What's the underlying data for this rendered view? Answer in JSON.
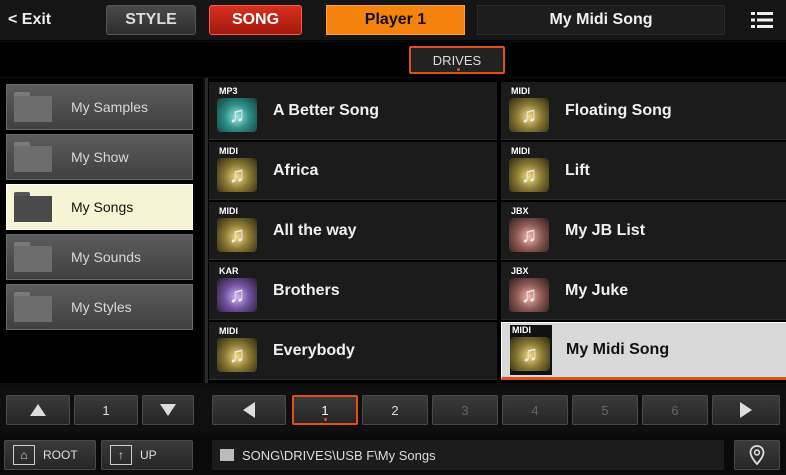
{
  "topbar": {
    "exit_label": "< Exit",
    "style_label": "STYLE",
    "song_label": "SONG",
    "player_label": "Player 1",
    "song_title": "My Midi Song",
    "menu_icon": "hamburger-menu-icon"
  },
  "drives": {
    "label": "DRIVES"
  },
  "folders": [
    {
      "label": "My Samples",
      "selected": false
    },
    {
      "label": "My Show",
      "selected": false
    },
    {
      "label": "My Songs",
      "selected": true
    },
    {
      "label": "My Sounds",
      "selected": false
    },
    {
      "label": "My Styles",
      "selected": false
    }
  ],
  "files": [
    {
      "type": "MP3",
      "name": "A Better Song"
    },
    {
      "type": "MIDI",
      "name": "Floating Song"
    },
    {
      "type": "MIDI",
      "name": "Africa"
    },
    {
      "type": "MIDI",
      "name": "Lift"
    },
    {
      "type": "MIDI",
      "name": "All the way"
    },
    {
      "type": "JBX",
      "name": "My JB List"
    },
    {
      "type": "KAR",
      "name": "Brothers"
    },
    {
      "type": "JBX",
      "name": "My Juke"
    },
    {
      "type": "MIDI",
      "name": "Everybody"
    },
    {
      "type": "MIDI",
      "name": "My Midi Song",
      "selected": true
    }
  ],
  "folder_nav": {
    "page": "1"
  },
  "file_pages": [
    "1",
    "2",
    "3",
    "4",
    "5",
    "6"
  ],
  "current_page": "1",
  "footer": {
    "root_label": "ROOT",
    "up_label": "UP",
    "path": "SONG\\DRIVES\\USB F\\My Songs"
  },
  "colors": {
    "accent": "#e0501c",
    "song_red": "#c72616",
    "player_orange": "#f5820d",
    "selected_folder": "#f7f4d6",
    "selected_file": "#d9d9d9"
  }
}
